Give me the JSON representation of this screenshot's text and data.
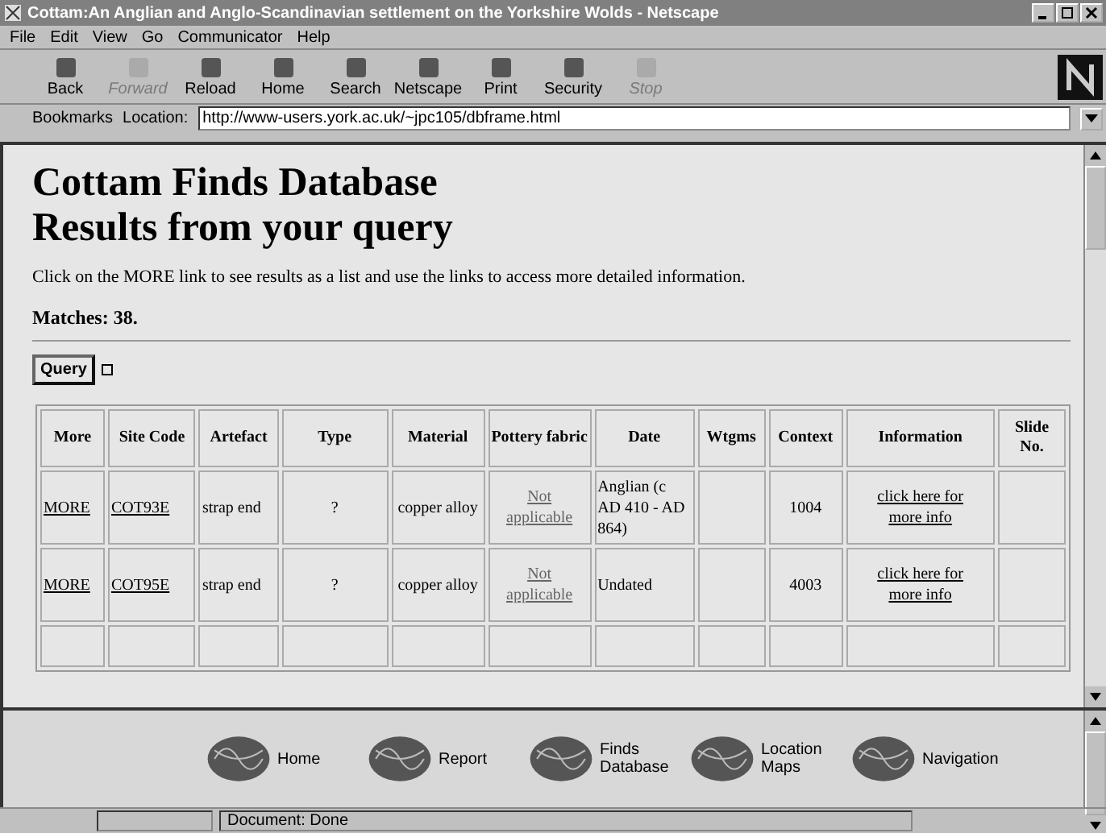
{
  "window": {
    "title": "Cottam:An Anglian and Anglo-Scandinavian settlement on the Yorkshire Wolds - Netscape"
  },
  "menu": [
    "File",
    "Edit",
    "View",
    "Go",
    "Communicator",
    "Help"
  ],
  "toolbar": [
    {
      "label": "Back",
      "disabled": false
    },
    {
      "label": "Forward",
      "disabled": true
    },
    {
      "label": "Reload",
      "disabled": false
    },
    {
      "label": "Home",
      "disabled": false
    },
    {
      "label": "Search",
      "disabled": false
    },
    {
      "label": "Netscape",
      "disabled": false
    },
    {
      "label": "Print",
      "disabled": false
    },
    {
      "label": "Security",
      "disabled": false
    },
    {
      "label": "Stop",
      "disabled": true
    }
  ],
  "location_bar": {
    "bookmarks": "Bookmarks",
    "label": "Location:",
    "url": "http://www-users.york.ac.uk/~jpc105/dbframe.html"
  },
  "page": {
    "heading": [
      "Cottam Finds Database",
      "Results from your query"
    ],
    "intro": "Click on the MORE link to see results as a list and use the links to access more detailed information.",
    "matches": "Matches: 38.",
    "query_button": "Query",
    "table": {
      "columns": [
        "More",
        "Site Code",
        "Artefact",
        "Type",
        "Material",
        "Pottery fabric",
        "Date",
        "Wtgms",
        "Context",
        "Information",
        "Slide No."
      ],
      "rows": [
        {
          "more": "MORE",
          "site_code": "COT93E",
          "artefact": "strap end",
          "type": "?",
          "material": "copper alloy",
          "pottery_fabric": "Not applicable",
          "date": "Anglian (c AD 410 - AD 864)",
          "wtgms": "",
          "context": "1004",
          "information": "click here for more info",
          "slide": ""
        },
        {
          "more": "MORE",
          "site_code": "COT95E",
          "artefact": "strap end",
          "type": "?",
          "material": "copper alloy",
          "pottery_fabric": "Not applicable",
          "date": "Undated",
          "wtgms": "",
          "context": "4003",
          "information": "click here for more info",
          "slide": ""
        }
      ]
    }
  },
  "nav_frame": [
    {
      "label": "Home"
    },
    {
      "label": "Report"
    },
    {
      "label": "Finds Database"
    },
    {
      "label": "Location Maps"
    },
    {
      "label": "Navigation"
    }
  ],
  "status_bar": {
    "text": "Document: Done"
  }
}
